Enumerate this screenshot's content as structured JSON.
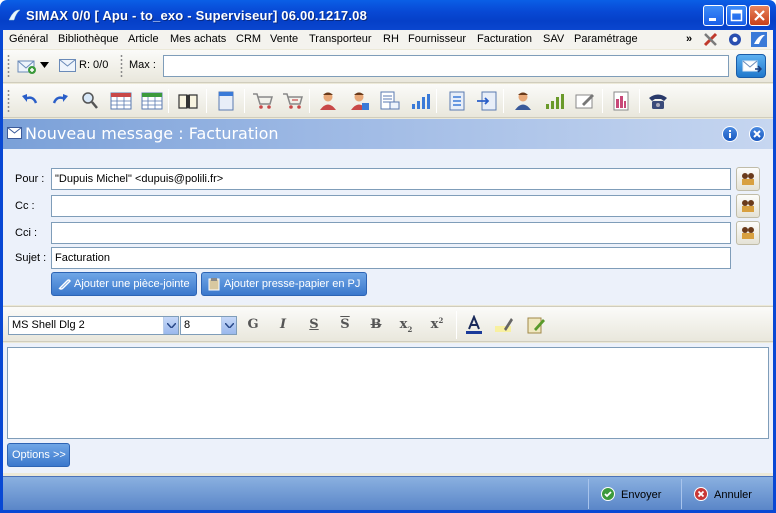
{
  "window": {
    "title": "SIMAX 0/0 [ Apu - to_exo - Superviseur] 06.00.1217.08"
  },
  "menu": {
    "items": [
      "Général",
      "Bibliothèque",
      "Article",
      "Mes achats",
      "CRM",
      "Vente",
      "Transporteur",
      "RH",
      "Fournisseur",
      "Facturation",
      "SAV",
      "Paramétrage"
    ],
    "overflow": "»"
  },
  "toolbar1": {
    "mail_count": "R: 0/0",
    "max_label": "Max :",
    "max_value": ""
  },
  "header": {
    "title": "Nouveau message : Facturation"
  },
  "form": {
    "to_label": "Pour :",
    "to_value": "\"Dupuis Michel\" <dupuis@polili.fr>",
    "cc_label": "Cc :",
    "cc_value": "",
    "bcc_label": "Cci :",
    "bcc_value": "",
    "subject_label": "Sujet :",
    "subject_value": "Facturation",
    "attach_button": "Ajouter une pièce-jointe",
    "clipboard_button": "Ajouter presse-papier en PJ"
  },
  "format": {
    "font": "MS Shell Dlg 2",
    "size": "8",
    "bold": "G",
    "italic": "I",
    "underline": "S",
    "overline": "S",
    "strike": "B",
    "subscript": "x",
    "superscript": "x",
    "sub_mark": "2",
    "sup_mark": "2"
  },
  "body": {
    "text": ""
  },
  "options_button": "Options >>",
  "actions": {
    "send": "Envoyer",
    "cancel": "Annuler"
  },
  "colors": {
    "titlebar": "#0848d4",
    "header_band": "#9cb8e4",
    "blue_button": "#3b78cc",
    "form_bg": "#ecf1fa"
  }
}
